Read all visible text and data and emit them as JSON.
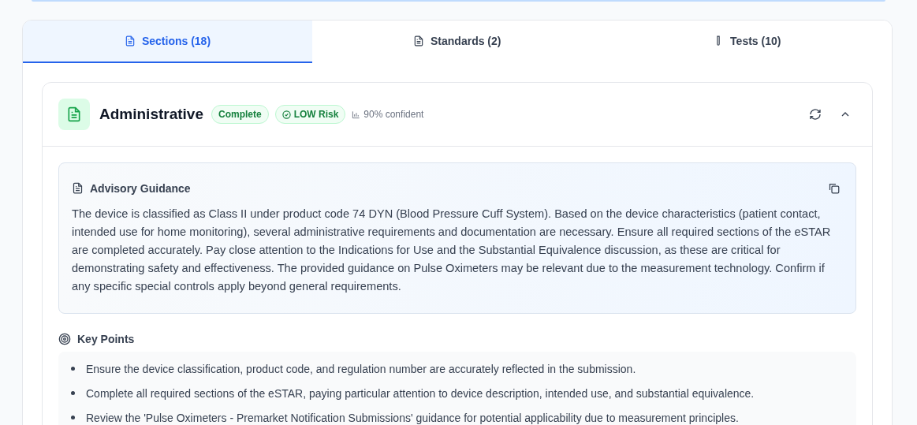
{
  "tabs": [
    {
      "label": "Sections (18)",
      "kind": "document",
      "selected": true
    },
    {
      "label": "Standards (2)",
      "kind": "document",
      "selected": false
    },
    {
      "label": "Tests (10)",
      "kind": "tube",
      "selected": false
    }
  ],
  "section": {
    "title": "Administrative",
    "status": "Complete",
    "risk": "LOW Risk",
    "confidence": "90% confident",
    "expanded": true,
    "guidance": {
      "title": "Advisory Guidance",
      "text": "The device is classified as Class II under product code 74 DYN (Blood Pressure Cuff System). Based on the device characteristics (patient contact, intended use for home monitoring), several administrative requirements and documentation are necessary. Ensure all required sections of the eSTAR are completed accurately. Pay close attention to the Indications for Use and the Substantial Equivalence discussion, as these are critical for demonstrating safety and effectiveness. The provided guidance on Pulse Oximeters may be relevant due to the measurement technology. Confirm if any specific special controls apply beyond general requirements."
    },
    "key_points": {
      "title": "Key Points",
      "items": [
        "Ensure the device classification, product code, and regulation number are accurately reflected in the submission.",
        "Complete all required sections of the eSTAR, paying particular attention to device description, intended use, and substantial equivalence.",
        "Review the 'Pulse Oximeters - Premarket Notification Submissions' guidance for potential applicability due to measurement principles."
      ]
    }
  }
}
